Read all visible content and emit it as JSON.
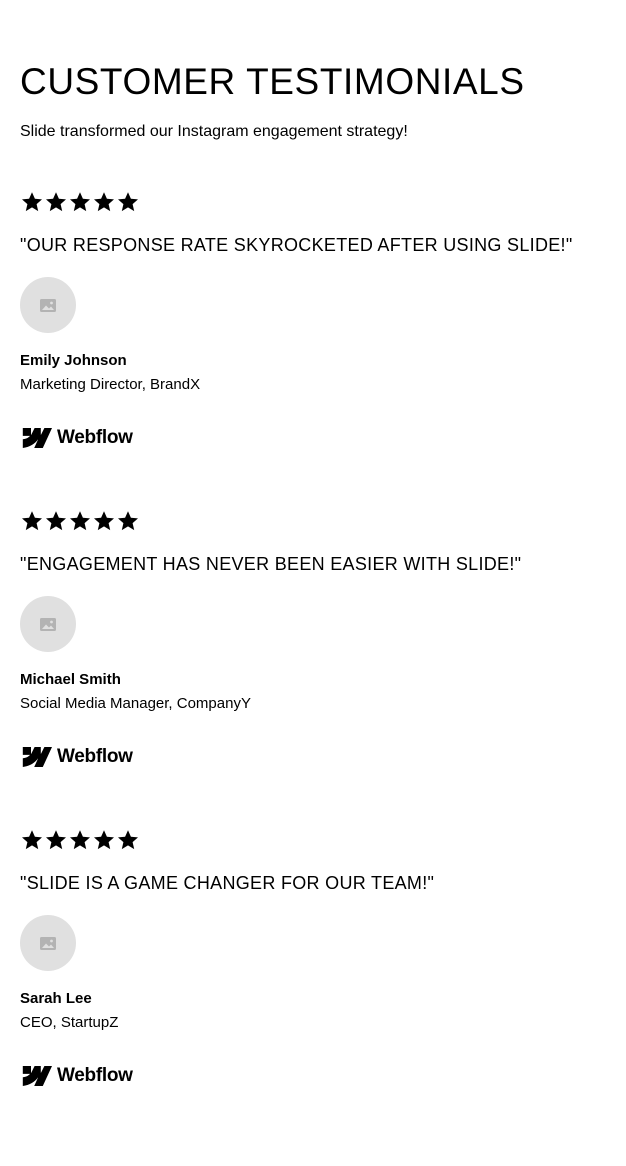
{
  "header": {
    "title": "CUSTOMER TESTIMONIALS",
    "subtitle": "Slide transformed our Instagram engagement strategy!"
  },
  "testimonials": [
    {
      "rating": 5,
      "quote": "\"OUR RESPONSE RATE SKYROCKETED AFTER USING SLIDE!\"",
      "avatar_icon": "image-placeholder-icon",
      "name": "Emily Johnson",
      "role": "Marketing Director, BrandX",
      "logo_text": "Webflow",
      "logo_icon": "webflow-logo-icon"
    },
    {
      "rating": 5,
      "quote": "\"ENGAGEMENT HAS NEVER BEEN EASIER WITH SLIDE!\"",
      "avatar_icon": "image-placeholder-icon",
      "name": "Michael Smith",
      "role": "Social Media Manager, CompanyY",
      "logo_text": "Webflow",
      "logo_icon": "webflow-logo-icon"
    },
    {
      "rating": 5,
      "quote": "\"SLIDE IS A GAME CHANGER FOR OUR TEAM!\"",
      "avatar_icon": "image-placeholder-icon",
      "name": "Sarah Lee",
      "role": "CEO, StartupZ",
      "logo_text": "Webflow",
      "logo_icon": "webflow-logo-icon"
    }
  ],
  "colors": {
    "text": "#000000",
    "background": "#ffffff",
    "avatar_bg": "#e0e0e0",
    "avatar_icon": "#b3b3b3"
  }
}
